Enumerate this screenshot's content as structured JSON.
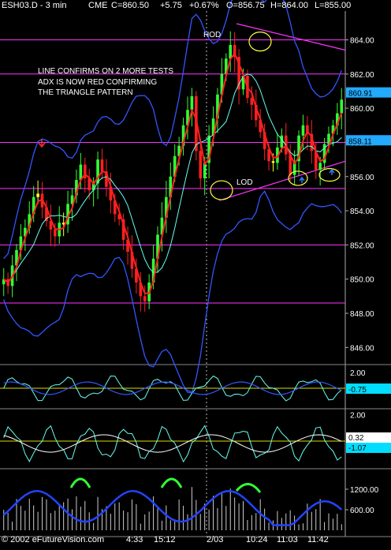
{
  "header": {
    "symbol": "ESH03.D - 3 min",
    "exchange": "CME",
    "close": "C=860.50",
    "change": "+5.75",
    "change_pct": "+0.67%",
    "open": "O=856.75",
    "high": "H=864.00",
    "low": "L=855.00"
  },
  "annotations": {
    "note_line1": "LINE CONFIRMS ON 2 MORE TESTS",
    "note_line2": "ADX IS NOW RED CONFIRMING",
    "note_line3": "THE TRIANGLE PATTERN",
    "hod": "HOD",
    "lod": "LOD"
  },
  "footer": {
    "copyright": "© 2002 eFutureVision.com",
    "time_labels": [
      "4:33",
      "15:12",
      "2/03",
      "10:24",
      "11:03",
      "11:42"
    ]
  },
  "colors": {
    "background": "#000000",
    "magenta_line": "#ff33ff",
    "bollinger": "#3355ff",
    "ma_fast": "#ff2020",
    "ma_slow": "#66ffee",
    "bull_bar": "#33ff33",
    "bear_bar": "#ff2020",
    "neutral_bar": "#ffff33",
    "price_box": "#22aaff"
  },
  "chart_data": [
    {
      "type": "candlestick",
      "name": "price",
      "ylim": [
        845,
        865.5
      ],
      "yticks": [
        "864.00",
        "862.00",
        "860.00",
        "858.00",
        "856.00",
        "854.00",
        "852.00",
        "850.00",
        "848.00",
        "846.00"
      ],
      "ytick_values": [
        864,
        862,
        860,
        858,
        856,
        854,
        852,
        850,
        848,
        846
      ],
      "horizontal_lines": [
        864,
        862,
        858,
        855.3,
        852,
        848.6
      ],
      "price_boxes": [
        "860.91",
        "858.11"
      ],
      "close_series": [
        850.0,
        849.6,
        850.8,
        851.7,
        852.5,
        853.0,
        853.8,
        854.8,
        855.0,
        854.2,
        853.4,
        852.9,
        852.5,
        853.3,
        853.2,
        854.4,
        854.9,
        855.8,
        856.7,
        855.9,
        855.2,
        855.6,
        857.0,
        856.3,
        855.4,
        854.6,
        853.8,
        853.5,
        852.3,
        851.6,
        850.6,
        849.8,
        849.0,
        848.7,
        849.8,
        851.2,
        852.6,
        853.6,
        854.8,
        856.0,
        857.2,
        857.8,
        859.0,
        859.9,
        860.7,
        857.5,
        855.9,
        856.8,
        858.4,
        859.4,
        860.8,
        862.0,
        862.9,
        863.7,
        863.0,
        861.1,
        861.9,
        860.6,
        860.2,
        859.3,
        858.6,
        857.6,
        856.9,
        856.8,
        857.7,
        858.4,
        857.3,
        856.1,
        856.9,
        858.4,
        859.0,
        858.5,
        857.5,
        856.4,
        856.8,
        857.9,
        858.5,
        859.0,
        859.7,
        860.5
      ]
    },
    {
      "type": "line",
      "name": "oscillator_1",
      "ylim": [
        -2.0,
        3.0
      ],
      "yticks": [
        "2.00"
      ],
      "ytick_values": [
        2.0
      ],
      "value_boxes": [
        "-0.75"
      ]
    },
    {
      "type": "line",
      "name": "oscillator_2",
      "ylim": [
        -2.6,
        2.6
      ],
      "yticks": [
        "2.00"
      ],
      "ytick_values": [
        2.0
      ],
      "value_boxes": [
        "0.32",
        "-1.07"
      ]
    },
    {
      "type": "bar",
      "name": "volume",
      "ylim": [
        0,
        1800
      ],
      "yticks": [
        "1200.00",
        "600.00"
      ],
      "ytick_values": [
        1200,
        600
      ]
    }
  ]
}
